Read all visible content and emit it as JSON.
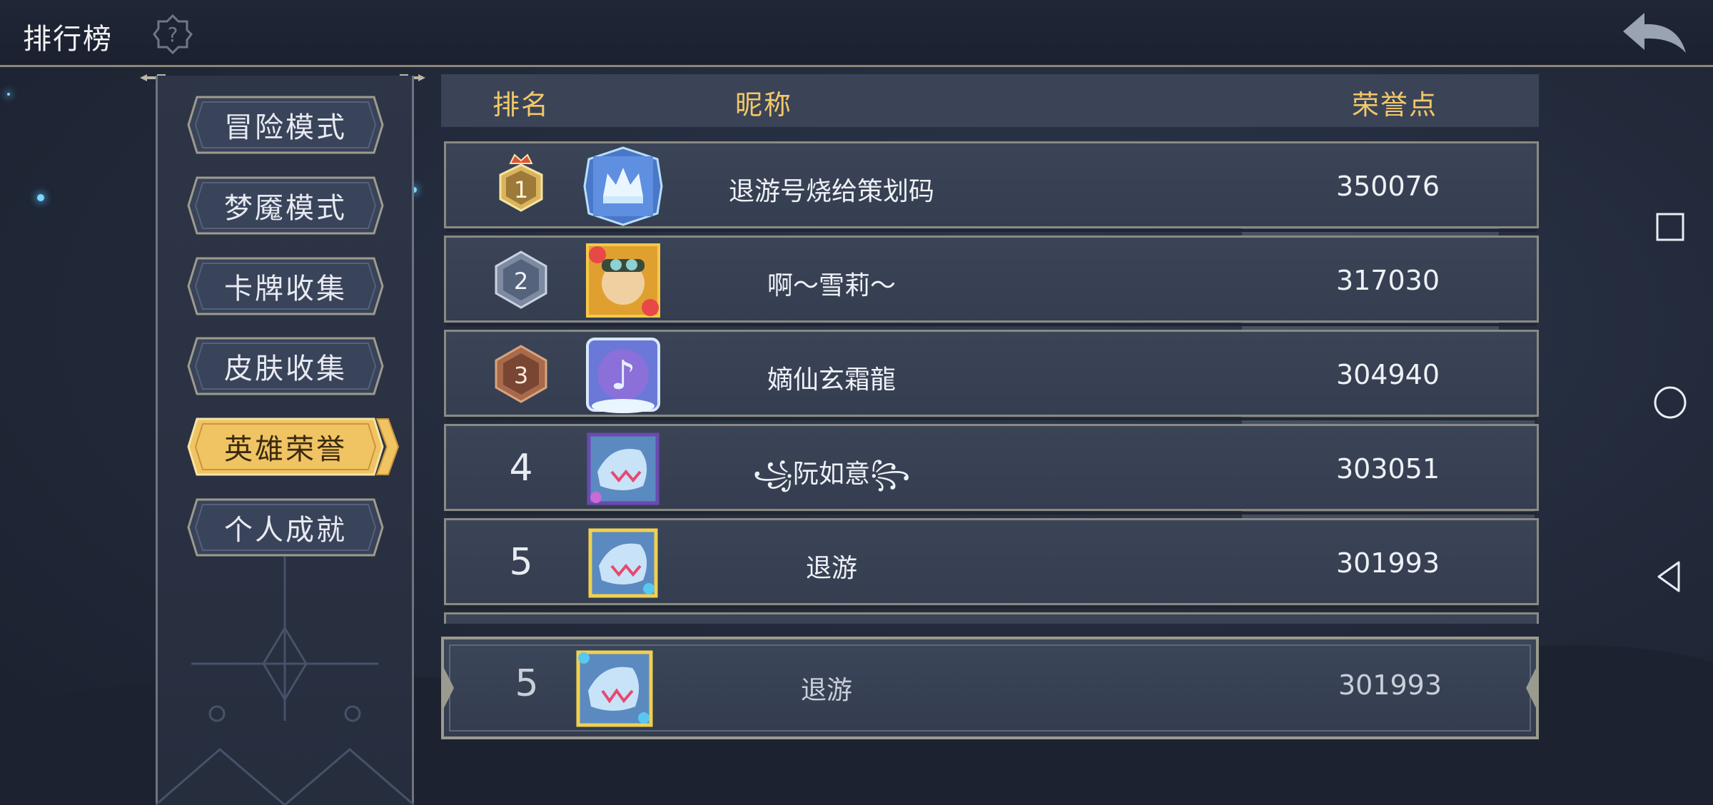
{
  "header": {
    "title": "排行榜",
    "help_icon": "question-gear-icon",
    "back_icon": "back-arrow-icon"
  },
  "sidebar": {
    "items": [
      {
        "label": "冒险模式",
        "active": false
      },
      {
        "label": "梦魇模式",
        "active": false
      },
      {
        "label": "卡牌收集",
        "active": false
      },
      {
        "label": "皮肤收集",
        "active": false
      },
      {
        "label": "英雄荣誉",
        "active": true
      },
      {
        "label": "个人成就",
        "active": false
      }
    ]
  },
  "table": {
    "columns": {
      "rank": "排名",
      "nickname": "昵称",
      "points": "荣誉点"
    },
    "rows": [
      {
        "rank": "1",
        "rank_badge": "gold-crown-badge-icon",
        "avatar": "ice-crown-avatar-icon",
        "nickname": "退游号烧给策划码",
        "points": "350076"
      },
      {
        "rank": "2",
        "rank_badge": "silver-badge-icon",
        "avatar": "goggles-girl-avatar-icon",
        "nickname": "啊～雪莉～",
        "points": "317030"
      },
      {
        "rank": "3",
        "rank_badge": "bronze-badge-icon",
        "avatar": "music-note-avatar-icon",
        "nickname": "嫡仙玄霜龍",
        "points": "304940"
      },
      {
        "rank": "4",
        "rank_badge": "",
        "avatar": "ice-dragon-avatar-icon",
        "nickname": "꧁阮如意꧂",
        "points": "303051"
      },
      {
        "rank": "5",
        "rank_badge": "",
        "avatar": "ice-dragon-gold-frame-avatar-icon",
        "nickname": "退游",
        "points": "301993"
      }
    ]
  },
  "my_rank": {
    "rank": "5",
    "avatar": "ice-dragon-gold-frame-avatar-icon",
    "nickname": "退游",
    "points": "301993"
  },
  "system_nav": {
    "recents_icon": "square-icon",
    "home_icon": "circle-icon",
    "back_icon": "triangle-back-icon"
  },
  "colors": {
    "header_gold": "#f3c868",
    "active_tab": "#f0c463",
    "row_bg": "#3b4457",
    "page_bg": "#232b3c"
  }
}
